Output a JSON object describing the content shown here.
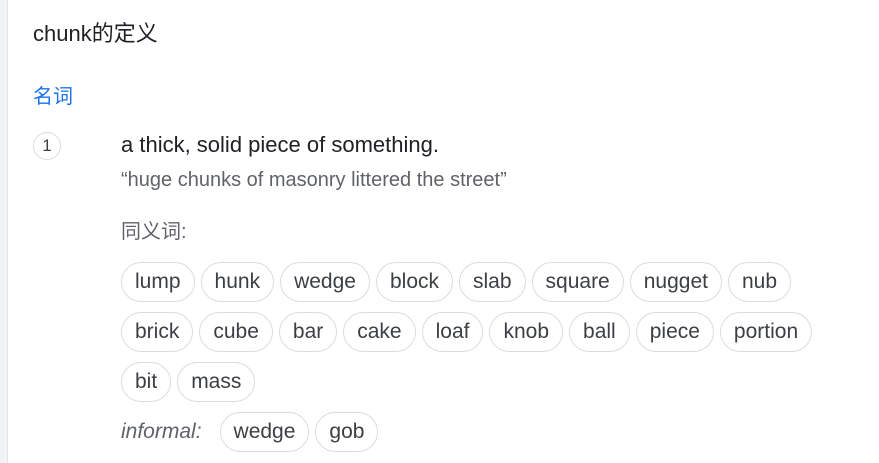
{
  "header": {
    "title": "chunk的定义"
  },
  "entry": {
    "part_of_speech": "名词",
    "senses": [
      {
        "number": "1",
        "definition": "a thick, solid piece of something.",
        "example": "“huge chunks of masonry littered the street”",
        "synonyms_label": "同义词:",
        "synonym_rows": [
          [
            "lump",
            "hunk",
            "wedge",
            "block",
            "slab",
            "square",
            "nugget",
            "nub"
          ],
          [
            "brick",
            "cube",
            "bar",
            "cake",
            "loaf",
            "knob",
            "ball",
            "piece",
            "portion"
          ],
          [
            "bit",
            "mass"
          ]
        ],
        "informal_label": "informal:",
        "informal_synonyms": [
          "wedge",
          "gob"
        ]
      }
    ]
  },
  "colors": {
    "part_of_speech": "#1a73e8",
    "chip_border": "#dadce0",
    "secondary_text": "#5f6368"
  }
}
